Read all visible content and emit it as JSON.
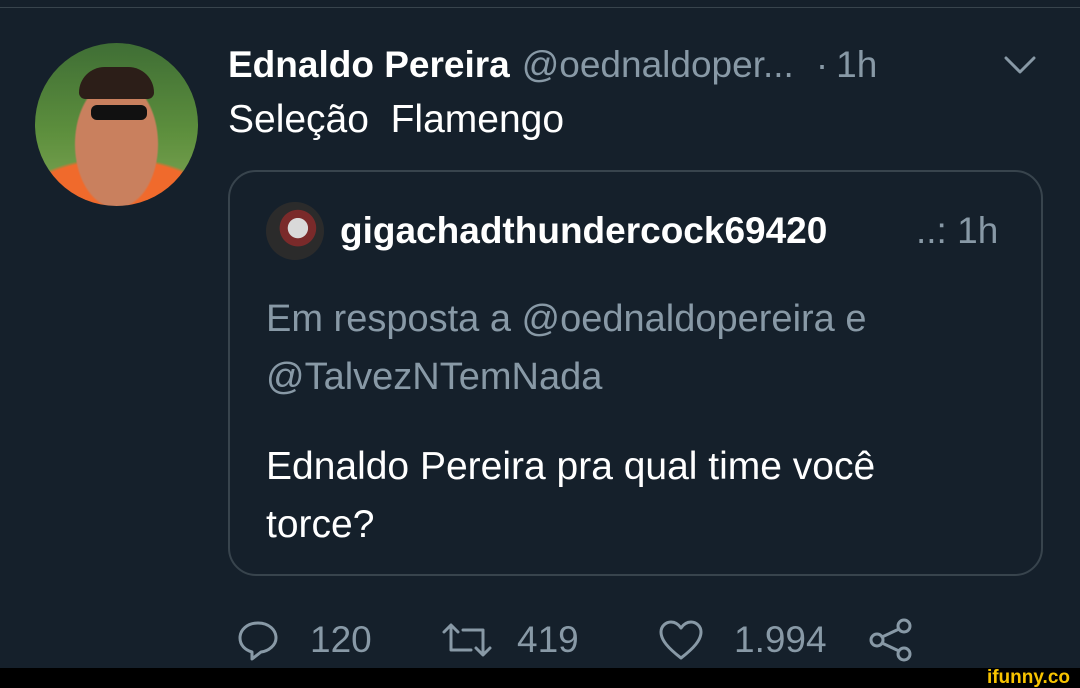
{
  "tweet": {
    "author_name": "Ednaldo Pereira",
    "author_handle": "@oednaldoper...",
    "separator": "·",
    "time": "1h",
    "text": "Seleção  Flamengo"
  },
  "quoted": {
    "author_name": "gigachadthundercock69420",
    "meta": "..: 1h",
    "reply_line1": "Em resposta a @oednaldopereira e",
    "reply_line2": "@TalvezNTemNada",
    "body_line1": "Ednaldo Pereira pra qual time você",
    "body_line2": "torce?"
  },
  "actions": {
    "replies": "120",
    "retweets": "419",
    "likes": "1.994"
  },
  "footer": {
    "brand": "ifunny.co"
  },
  "icons": [
    "chevron-down-icon",
    "reply-icon",
    "retweet-icon",
    "like-icon",
    "share-icon"
  ],
  "colors": {
    "background": "#15202b",
    "secondary_text": "#8899a6",
    "border": "#38444d",
    "brand": "#f8c400"
  }
}
